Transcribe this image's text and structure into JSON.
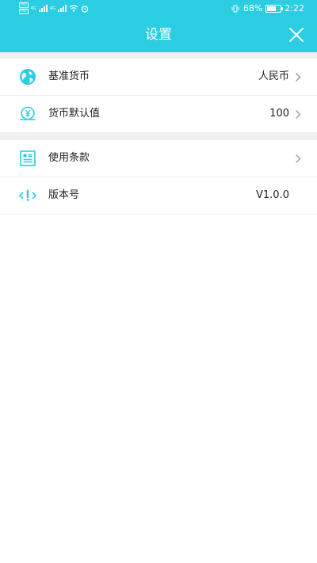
{
  "status_bar": {
    "net_left_1": "HD",
    "net_left_2": "HD",
    "carrier_1": "4G",
    "carrier_2": "4G",
    "battery_percent": "68%",
    "battery_level": 0.68,
    "time": "2:22"
  },
  "header": {
    "title": "设置",
    "background_color": "#2bcde3"
  },
  "settings": {
    "items": [
      {
        "label": "基准货币",
        "value": "人民币",
        "icon": "globe-icon",
        "has_chevron": true
      },
      {
        "label": "货币默认值",
        "value": "100",
        "icon": "yen-coin-icon",
        "has_chevron": true
      },
      {
        "label": "使用条款",
        "value": "",
        "icon": "document-icon",
        "has_chevron": true
      },
      {
        "label": "版本号",
        "value": "V1.0.0",
        "icon": "code-info-icon",
        "has_chevron": false
      }
    ]
  },
  "colors": {
    "accent": "#2bcde3",
    "divider": "#eeeeee",
    "section_gap": "#f0f0f0"
  }
}
